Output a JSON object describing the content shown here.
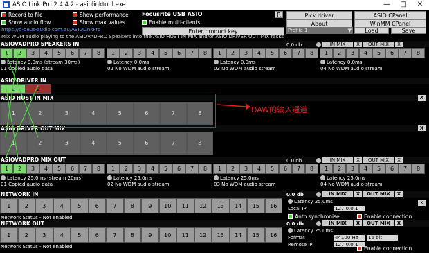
{
  "window": {
    "title": "ASIO Link Pro 2.4.4.2 - asiolinktool.exe",
    "controls": [
      "—",
      "□",
      "✕"
    ]
  },
  "options": {
    "record_to_file": "Record to file",
    "show_audio_flow": "Show audio flow",
    "show_performance": "Show performance",
    "show_max_values": "Show max values",
    "device": "Focusrite USB ASIO",
    "r_label": "R",
    "enable_multi_clients": "Enable multi-clients",
    "link": "https://o-deus-audio.com.au/ASIOLinkPro",
    "info": "Mix WDM audio playing to the ASIOVADPRO Speakers into the ASIO HOST IN MIX and/or ASIO DRIVER OUT MIX racks"
  },
  "buttons": {
    "pick_driver": "Pick driver",
    "asio_cpanel": "ASIO CPanel",
    "about": "About",
    "winmm_cpanel": "WinMM CPanel",
    "enter_product_key": "Enter product key",
    "profile": "Profile 1",
    "load": "Load",
    "save": "Save"
  },
  "speakers": {
    "title": "ASIOVADPRO SPEAKERS IN",
    "db": "0.0 db",
    "in_mix": "IN MIX",
    "out_mix": "OUT MIX",
    "x": "X",
    "one": "1-1",
    "latency": [
      "Latency 0.0ms (stream 30ms)",
      "Latency 0.0ms",
      "Latency 0.0ms",
      "Latency 0.0ms"
    ],
    "status": [
      "01 Copied audio data",
      "02 No WDM audio stream",
      "03 No WDM audio stream",
      "04 No WDM audio stream"
    ],
    "groups": [
      [
        "1",
        "2",
        "3",
        "4",
        "5",
        "6",
        "7",
        "8"
      ],
      [
        "1",
        "2",
        "3",
        "4",
        "5",
        "6",
        "7",
        "8"
      ],
      [
        "1",
        "2",
        "3",
        "4",
        "5",
        "6",
        "7",
        "8"
      ],
      [
        "1",
        "2",
        "3",
        "4",
        "5",
        "6",
        "7",
        "8"
      ]
    ]
  },
  "driver_in": {
    "title": "ASIO DRIVER IN",
    "channels": [
      "1",
      "2"
    ]
  },
  "host_in": {
    "title": "ASIO HOST IN MIX",
    "channels": [
      "1",
      "2",
      "3",
      "4",
      "5",
      "6",
      "7",
      "8"
    ]
  },
  "annotation": "DAW的输入通道",
  "driver_out": {
    "title": "ASIO DRIVER OUT MIX",
    "channels": [
      "1",
      "2",
      "3",
      "4",
      "5",
      "6",
      "7",
      "8"
    ]
  },
  "mixout": {
    "title": "ASIOVADPRO MIX OUT",
    "db": "0.0 db",
    "in_mix": "IN MIX",
    "out_mix": "OUT MIX",
    "x": "X",
    "latency": [
      "Latency 25.0ms (stream 20ms)",
      "Latency 25.0ms",
      "Latency 25.0ms",
      "Latency 25.0ms"
    ],
    "status": [
      "01 Copied audio data",
      "02 No WDM audio stream",
      "03 No WDM audio stream",
      "04 No WDM audio stream"
    ],
    "groups": [
      [
        "1",
        "2",
        "3",
        "4",
        "5",
        "6",
        "7",
        "8"
      ],
      [
        "1",
        "2",
        "3",
        "4",
        "5",
        "6",
        "7",
        "8"
      ],
      [
        "1",
        "2",
        "3",
        "4",
        "5",
        "6",
        "7",
        "8"
      ],
      [
        "1",
        "2",
        "3",
        "4",
        "5",
        "6",
        "7",
        "8"
      ]
    ]
  },
  "network_in": {
    "title": "NETWORK IN",
    "db": "0.0 db",
    "in_mix": "IN MIX",
    "out_mix": "OUT MIX",
    "channels": [
      "1",
      "2",
      "3",
      "4",
      "5",
      "6",
      "7",
      "8",
      "9",
      "10",
      "11",
      "12",
      "13",
      "14",
      "15",
      "16"
    ],
    "status": "Network Status - Not enabled",
    "latency": "Latency 25.0ms",
    "local_ip_label": "Local IP",
    "local_ip": "127.0.0.1",
    "auto_sync": "Auto synchronise",
    "enable_connection": "Enable connection"
  },
  "network_out": {
    "title": "NETWORK OUT",
    "db": "0.0 db",
    "in_mix": "IN MIX",
    "out_mix": "OUT MIX",
    "channels": [
      "1",
      "2",
      "3",
      "4",
      "5",
      "6",
      "7",
      "8",
      "9",
      "10",
      "11",
      "12",
      "13",
      "14",
      "15",
      "16"
    ],
    "status": "Network Status - Not enabled",
    "latency": "Latency 25.0ms",
    "format_label": "Format",
    "format_rate": "44100 Hz",
    "format_bits": "16 bit",
    "remote_ip_label": "Remote IP",
    "remote_ip": "127.0.0.1",
    "enable_connection": "Enable connection"
  }
}
